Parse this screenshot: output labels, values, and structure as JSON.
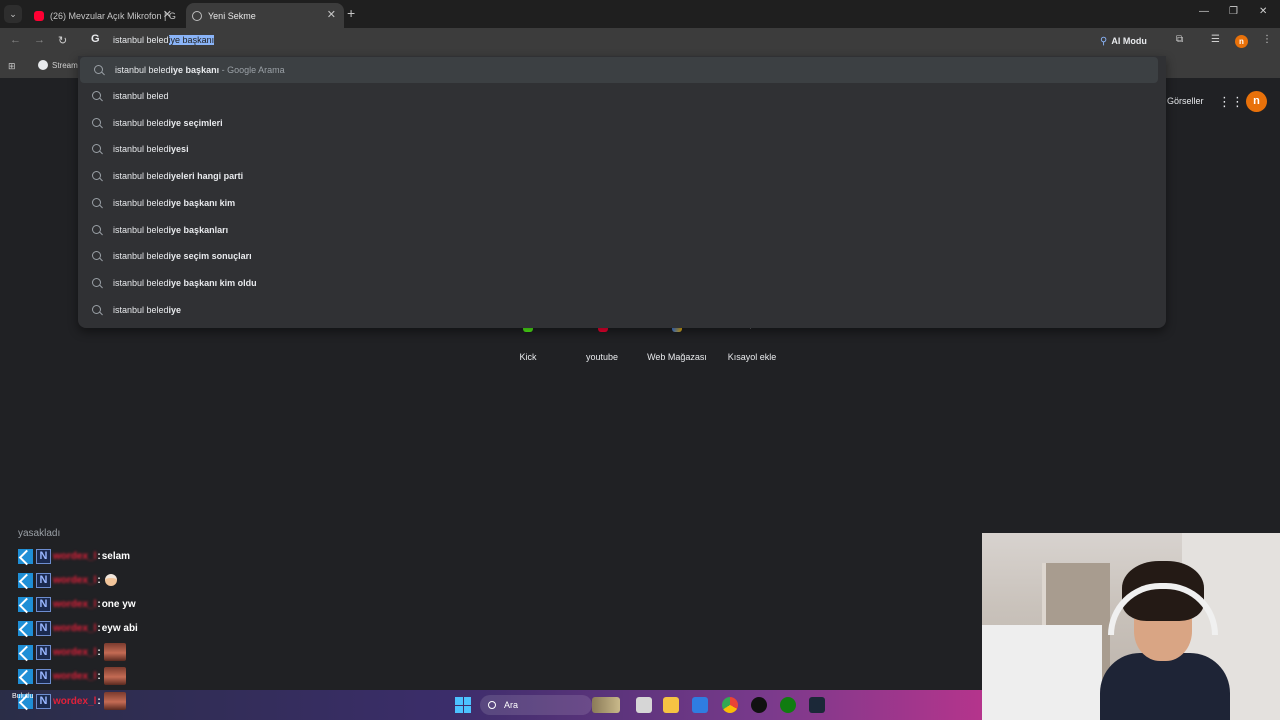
{
  "browser": {
    "tabs": [
      {
        "title": "(26) Mevzular Açık Mikrofon | G",
        "active": false,
        "favicon": "youtube-icon"
      },
      {
        "title": "Yeni Sekme",
        "active": true,
        "favicon": "chrome-icon"
      }
    ],
    "omnibox": {
      "typed": "istanbul beled",
      "autocomplete": "iye başkanı"
    },
    "ai_mode_label": "AI Modu",
    "profile_initial": "n",
    "bookmark_label": "Stream"
  },
  "suggestions": [
    {
      "plain": "istanbul beled",
      "bold": "iye başkanı",
      "source": " - Google Arama"
    },
    {
      "plain": "istanbul beled",
      "bold": "",
      "source": ""
    },
    {
      "plain": "istanbul beled",
      "bold": "iye seçimleri",
      "source": ""
    },
    {
      "plain": "istanbul beled",
      "bold": "iyesi",
      "source": ""
    },
    {
      "plain": "istanbul beled",
      "bold": "iyeleri hangi parti",
      "source": ""
    },
    {
      "plain": "istanbul beled",
      "bold": "iye başkanı kim",
      "source": ""
    },
    {
      "plain": "istanbul beled",
      "bold": "iye başkanları",
      "source": ""
    },
    {
      "plain": "istanbul beled",
      "bold": "iye seçim sonuçları",
      "source": ""
    },
    {
      "plain": "istanbul beled",
      "bold": "iye başkanı kim oldu",
      "source": ""
    },
    {
      "plain": "istanbul beled",
      "bold": "iye",
      "source": ""
    }
  ],
  "newtab": {
    "images_label": "Görseller",
    "shortcuts": [
      "Kick",
      "youtube",
      "Web Mağazası",
      "Kısayol ekle"
    ]
  },
  "chat": {
    "partial_line": "yasakladı",
    "messages": [
      {
        "user": "wordex_l",
        "text": "selam",
        "emote": "none"
      },
      {
        "user": "wordex_l",
        "text": "",
        "emote": "thumbs-up-emote"
      },
      {
        "user": "wordex_l",
        "text": "one yw",
        "emote": "none"
      },
      {
        "user": "wordex_l",
        "text": "eyw abi",
        "emote": "none"
      },
      {
        "user": "wordex_l",
        "text": "",
        "emote": "face-emote"
      },
      {
        "user": "wordex_l",
        "text": "",
        "emote": "face-emote"
      },
      {
        "user": "wordex_l",
        "text": "",
        "emote": "face-emote"
      }
    ]
  },
  "taskbar": {
    "search_placeholder": "Ara",
    "weather_text": "Bulutlu"
  },
  "colors": {
    "accent": "#8ab4f8",
    "chat_user": "#e0213a",
    "profile": "#e8710a"
  }
}
